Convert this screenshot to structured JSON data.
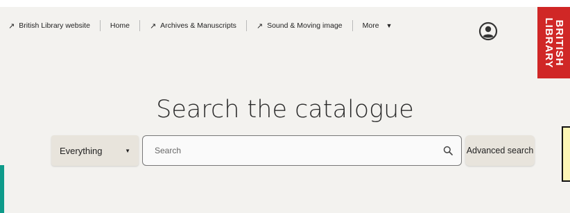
{
  "nav": {
    "items": [
      {
        "label": "British Library website",
        "arrow": "↗"
      },
      {
        "label": "Home"
      },
      {
        "label": "Archives & Manuscripts",
        "arrow": "↗"
      },
      {
        "label": "Sound & Moving image",
        "arrow": "↗"
      },
      {
        "label": "More",
        "caret": "▼"
      }
    ]
  },
  "account": {
    "icon": "account-circle-icon"
  },
  "logo": {
    "line1": "BRITISH",
    "line2": "LIBRARY",
    "color": "#d02726"
  },
  "main": {
    "title": "Search the catalogue",
    "scope": {
      "selected": "Everything",
      "caret": "▼"
    },
    "search": {
      "placeholder": "Search",
      "value": ""
    },
    "advanced_label": "Advanced search"
  },
  "colors": {
    "accent_teal": "#0e9b8a",
    "background": "#f3f2ef",
    "button_bg": "#e8e4dc"
  }
}
